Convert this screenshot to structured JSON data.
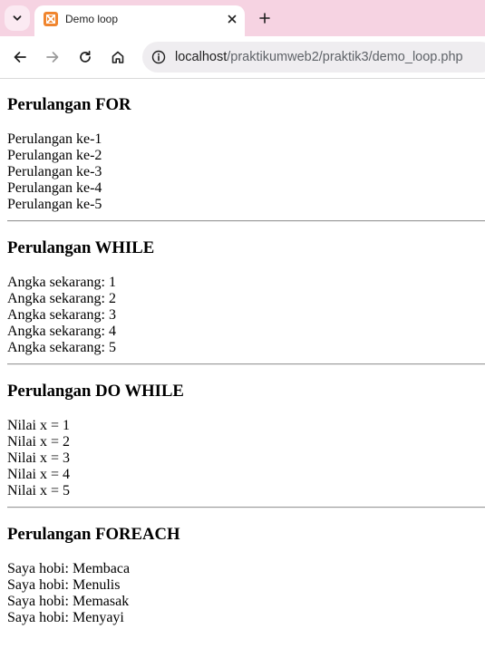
{
  "browser": {
    "tab_title": "Demo loop",
    "url_host": "localhost",
    "url_path": "/praktikumweb2/praktik3/demo_loop.php",
    "icons": {
      "tab_menu": "chevron-down-icon",
      "favicon": "xampp-icon",
      "close": "close-icon",
      "new_tab": "plus-icon",
      "back": "back-arrow-icon",
      "forward": "forward-arrow-icon",
      "reload": "reload-icon",
      "home": "home-icon",
      "site_info": "site-info-icon"
    },
    "colors": {
      "tabstrip": "#f6d3e2",
      "omnibox": "#efedf0",
      "favicon": "#f0852e"
    }
  },
  "sections": {
    "for": {
      "heading": "Perulangan FOR",
      "lines": [
        "Perulangan ke-1",
        "Perulangan ke-2",
        "Perulangan ke-3",
        "Perulangan ke-4",
        "Perulangan ke-5"
      ]
    },
    "while": {
      "heading": "Perulangan WHILE",
      "lines": [
        "Angka sekarang: 1",
        "Angka sekarang: 2",
        "Angka sekarang: 3",
        "Angka sekarang: 4",
        "Angka sekarang: 5"
      ]
    },
    "do_while": {
      "heading": "Perulangan DO WHILE",
      "lines": [
        "Nilai x = 1",
        "Nilai x = 2",
        "Nilai x = 3",
        "Nilai x = 4",
        "Nilai x = 5"
      ]
    },
    "foreach": {
      "heading": "Perulangan FOREACH",
      "lines": [
        "Saya hobi: Membaca",
        "Saya hobi: Menulis",
        "Saya hobi: Memasak",
        "Saya hobi: Menyayi"
      ]
    }
  }
}
